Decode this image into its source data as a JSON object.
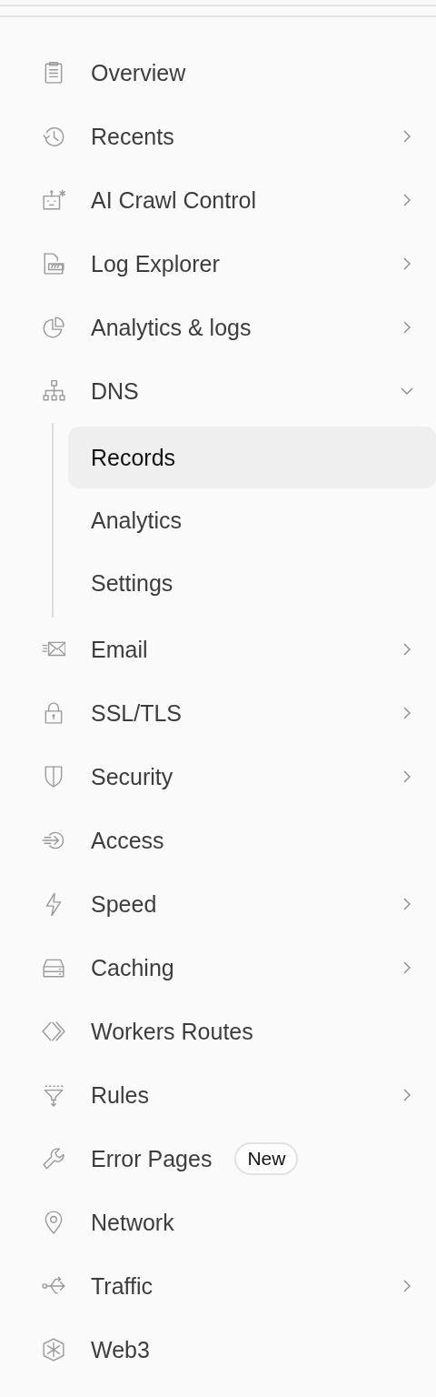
{
  "sidebar": {
    "items": [
      {
        "label": "Overview",
        "expandable": false
      },
      {
        "label": "Recents",
        "expandable": true,
        "expanded": false
      },
      {
        "label": "AI Crawl Control",
        "expandable": true,
        "expanded": false
      },
      {
        "label": "Log Explorer",
        "expandable": true,
        "expanded": false
      },
      {
        "label": "Analytics & logs",
        "expandable": true,
        "expanded": false
      },
      {
        "label": "DNS",
        "expandable": true,
        "expanded": true,
        "children": [
          {
            "label": "Records",
            "selected": true
          },
          {
            "label": "Analytics",
            "selected": false
          },
          {
            "label": "Settings",
            "selected": false
          }
        ]
      },
      {
        "label": "Email",
        "expandable": true,
        "expanded": false
      },
      {
        "label": "SSL/TLS",
        "expandable": true,
        "expanded": false
      },
      {
        "label": "Security",
        "expandable": true,
        "expanded": false
      },
      {
        "label": "Access",
        "expandable": false
      },
      {
        "label": "Speed",
        "expandable": true,
        "expanded": false
      },
      {
        "label": "Caching",
        "expandable": true,
        "expanded": false
      },
      {
        "label": "Workers Routes",
        "expandable": false
      },
      {
        "label": "Rules",
        "expandable": true,
        "expanded": false
      },
      {
        "label": "Error Pages",
        "expandable": false,
        "badge": "New"
      },
      {
        "label": "Network",
        "expandable": false
      },
      {
        "label": "Traffic",
        "expandable": true,
        "expanded": false
      },
      {
        "label": "Web3",
        "expandable": false
      }
    ]
  }
}
